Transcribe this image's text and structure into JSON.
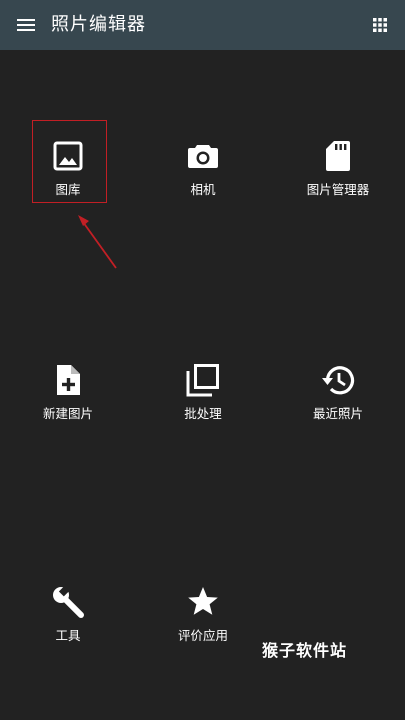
{
  "app_bar": {
    "title": "照片编辑器",
    "menu_icon": "hamburger-menu-icon",
    "more_icon": "app-grid-icon",
    "background": "#37474f"
  },
  "tiles": [
    {
      "label": "图库",
      "icon": "image-icon"
    },
    {
      "label": "相机",
      "icon": "camera-icon"
    },
    {
      "label": "图片管理器",
      "icon": "sd-card-icon"
    },
    {
      "label": "新建图片",
      "icon": "new-file-icon"
    },
    {
      "label": "批处理",
      "icon": "batch-copy-icon"
    },
    {
      "label": "最近照片",
      "icon": "history-icon"
    },
    {
      "label": "工具",
      "icon": "wrench-icon"
    },
    {
      "label": "评价应用",
      "icon": "star-icon"
    }
  ],
  "annotation": {
    "highlight_color": "#c21f25",
    "watermark": "猴子软件站"
  }
}
